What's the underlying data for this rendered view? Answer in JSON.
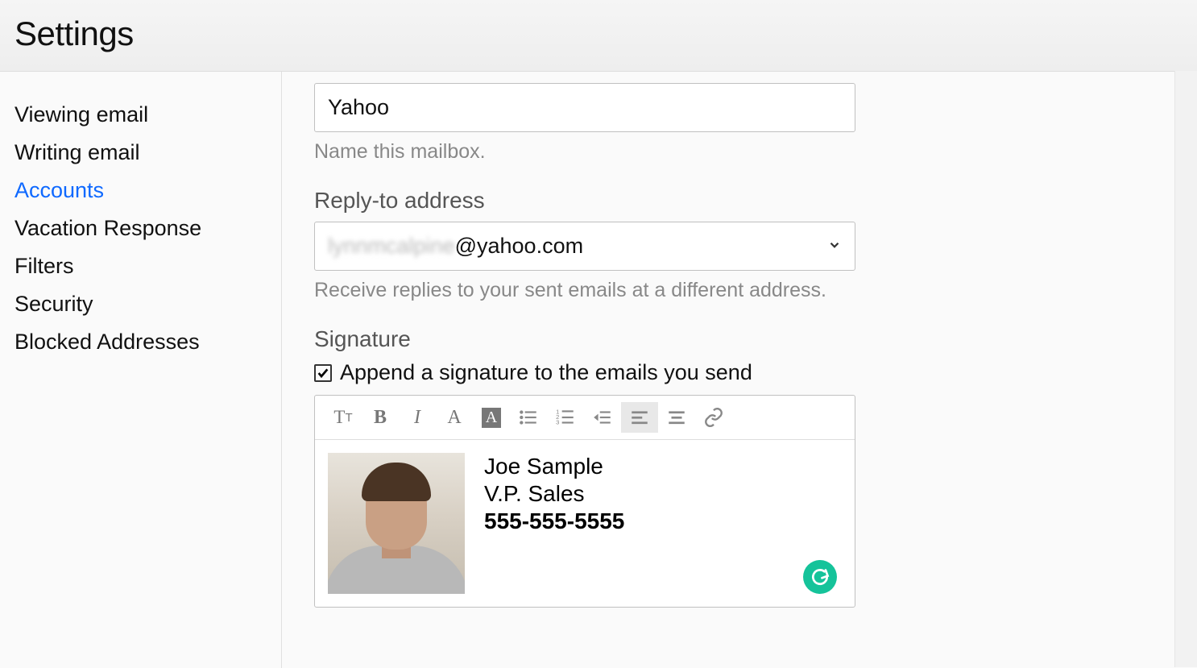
{
  "header": {
    "title": "Settings"
  },
  "sidebar": {
    "items": [
      {
        "label": "Viewing email",
        "active": false
      },
      {
        "label": "Writing email",
        "active": false
      },
      {
        "label": "Accounts",
        "active": true
      },
      {
        "label": "Vacation Response",
        "active": false
      },
      {
        "label": "Filters",
        "active": false
      },
      {
        "label": "Security",
        "active": false
      },
      {
        "label": "Blocked Addresses",
        "active": false
      }
    ]
  },
  "mailbox": {
    "value": "Yahoo",
    "helper": "Name this mailbox."
  },
  "reply_to": {
    "label": "Reply-to address",
    "email_local_masked": "lynnmcalpine",
    "email_domain": "@yahoo.com",
    "helper": "Receive replies to your sent emails at a different address."
  },
  "signature": {
    "label": "Signature",
    "checkbox_checked": true,
    "checkbox_label": "Append a signature to the emails you send",
    "content": {
      "name": "Joe Sample",
      "title": "V.P. Sales",
      "phone": "555-555-5555"
    }
  },
  "toolbar_icons": [
    "text-size-icon",
    "bold-icon",
    "italic-icon",
    "text-color-icon",
    "highlight-icon",
    "bullet-list-icon",
    "numbered-list-icon",
    "indent-icon",
    "align-left-icon",
    "align-center-icon",
    "link-icon"
  ],
  "grammarly_icon": "G"
}
